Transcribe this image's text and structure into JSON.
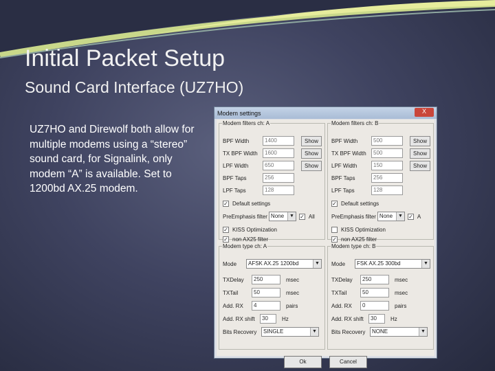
{
  "slide": {
    "title": "Initial Packet Setup",
    "subtitle": "Sound Card Interface (UZ7HO)",
    "body": "UZ7HO and Direwolf both allow for multiple modems using a “stereo” sound card, for Signalink, only modem “A” is available. Set to 1200bd AX.25 modem."
  },
  "dialog": {
    "title": "Modem settings",
    "close": "X",
    "filters": [
      {
        "legend": "Modem filters ch: A",
        "fields": [
          {
            "label": "BPF Width",
            "value": "1400",
            "show": "Show"
          },
          {
            "label": "TX BPF Width",
            "value": "1600",
            "show": "Show"
          },
          {
            "label": "LPF Width",
            "value": "650",
            "show": "Show"
          },
          {
            "label": "BPF Taps",
            "value": "256"
          },
          {
            "label": "LPF Taps",
            "value": "128"
          }
        ],
        "default_settings": "Default settings",
        "preemphasis_label": "PreEmphasis filter",
        "preemphasis_value": "None",
        "all_label": "All",
        "kiss": "KISS Optimization",
        "non_ax25": "non AX25 filter"
      },
      {
        "legend": "Modem filters ch: B",
        "fields": [
          {
            "label": "BPF Width",
            "value": "500",
            "show": "Show"
          },
          {
            "label": "TX BPF Width",
            "value": "500",
            "show": "Show"
          },
          {
            "label": "LPF Width",
            "value": "150",
            "show": "Show"
          },
          {
            "label": "BPF Taps",
            "value": "256"
          },
          {
            "label": "LPF Taps",
            "value": "128"
          }
        ],
        "default_settings": "Default settings",
        "preemphasis_label": "PreEmphasis filter",
        "preemphasis_value": "None",
        "all_label": "A",
        "kiss": "KISS Optimization",
        "non_ax25": "non AX25 filter"
      }
    ],
    "types": [
      {
        "legend": "Modem type ch: A",
        "mode_label": "Mode",
        "mode": "AFSK AX.25 1200bd",
        "txdelay_label": "TXDelay",
        "txdelay": "250",
        "txtail_label": "TXTail",
        "txtail": "50",
        "addrx_label": "Add. RX",
        "addrx": "4",
        "addrx_unit": "pairs",
        "shift_label": "Add. RX shift",
        "shift": "30",
        "shift_unit": "Hz",
        "msec": "msec",
        "bits_label": "Bits Recovery",
        "bits": "SINGLE"
      },
      {
        "legend": "Modem type ch: B",
        "mode_label": "Mode",
        "mode": "FSK AX.25 300bd",
        "txdelay_label": "TXDelay",
        "txdelay": "250",
        "txtail_label": "TXTail",
        "txtail": "50",
        "addrx_label": "Add. RX",
        "addrx": "0",
        "addrx_unit": "pairs",
        "shift_label": "Add. RX shift",
        "shift": "30",
        "shift_unit": "Hz",
        "msec": "msec",
        "bits_label": "Bits Recovery",
        "bits": "NONE"
      }
    ],
    "ok": "Ok",
    "cancel": "Cancel"
  }
}
